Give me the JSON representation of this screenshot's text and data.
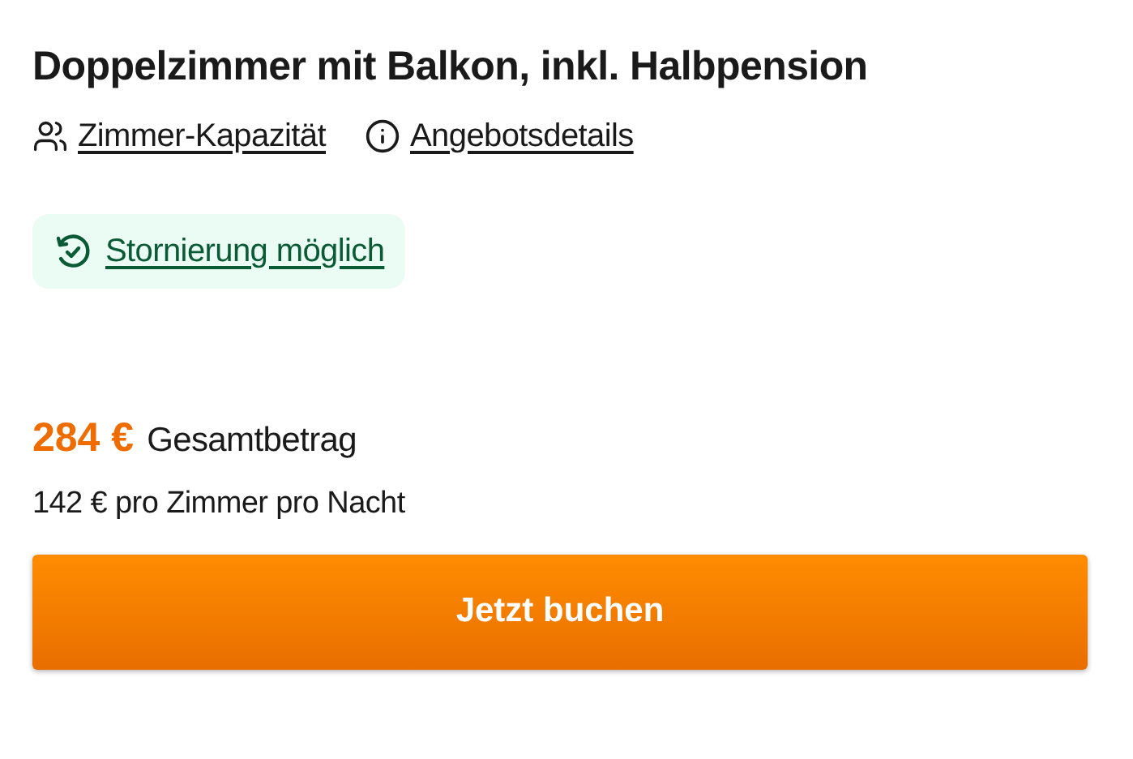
{
  "title": "Doppelzimmer mit Balkon, inkl. Halbpension",
  "links": [
    {
      "kind": "capacity",
      "label": "Zimmer-Kapazität"
    },
    {
      "kind": "details",
      "label": "Angebotsdetails"
    }
  ],
  "cancellation": {
    "label": "Stornierung möglich"
  },
  "price": {
    "amount": "284 €",
    "label": "Gesamtbetrag",
    "per_night": "142 € pro Zimmer pro Nacht"
  },
  "book_button": "Jetzt buchen"
}
